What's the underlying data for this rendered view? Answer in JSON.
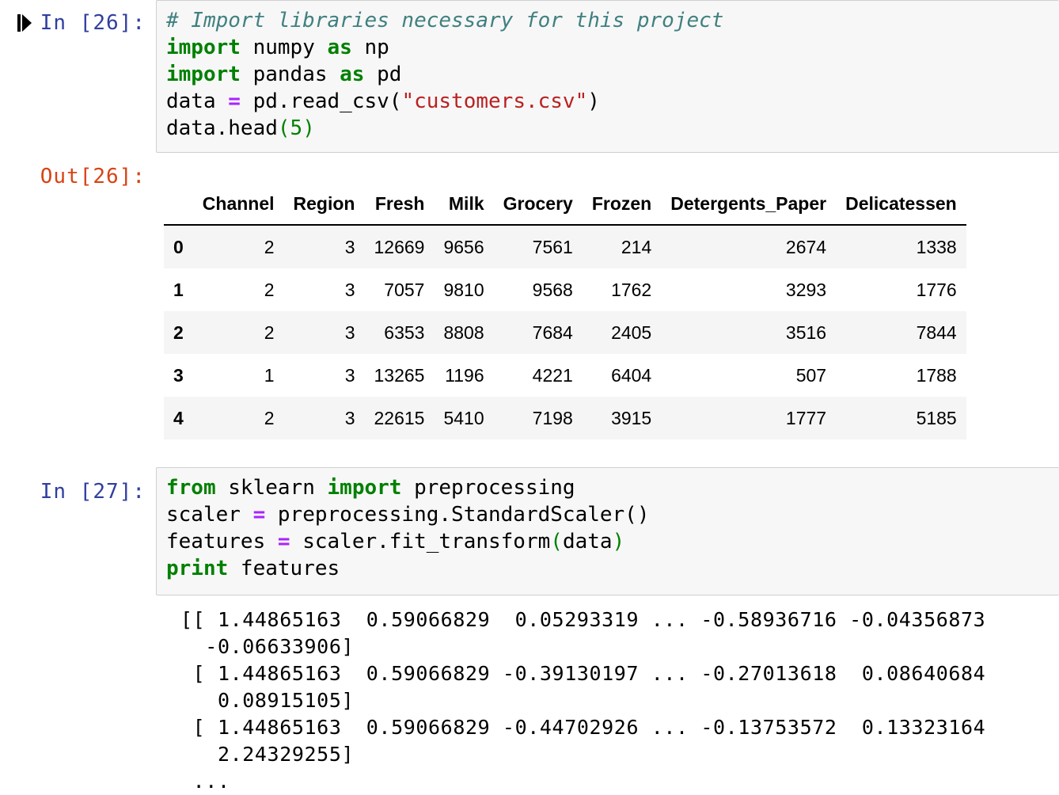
{
  "cells": [
    {
      "prompt": "In [26]:",
      "code_lines": [
        [
          {
            "t": "# Import libraries necessary for this project",
            "c": "cm"
          }
        ],
        [
          {
            "t": "import",
            "c": "kw"
          },
          {
            "t": " numpy ",
            "c": "pn"
          },
          {
            "t": "as",
            "c": "kw"
          },
          {
            "t": " np",
            "c": "pn"
          }
        ],
        [
          {
            "t": "import",
            "c": "kw"
          },
          {
            "t": " pandas ",
            "c": "pn"
          },
          {
            "t": "as",
            "c": "kw"
          },
          {
            "t": " pd",
            "c": "pn"
          }
        ],
        [
          {
            "t": "data ",
            "c": "pn"
          },
          {
            "t": "=",
            "c": "op"
          },
          {
            "t": " pd.read_csv(",
            "c": "pn"
          },
          {
            "t": "\"customers.csv\"",
            "c": "st"
          },
          {
            "t": ")",
            "c": "pn"
          }
        ],
        [
          {
            "t": "data.head",
            "c": "pn"
          },
          {
            "t": "(",
            "c": "num"
          },
          {
            "t": "5",
            "c": "num"
          },
          {
            "t": ")",
            "c": "num"
          }
        ]
      ],
      "out_prompt": "Out[26]:",
      "table": {
        "columns": [
          "Channel",
          "Region",
          "Fresh",
          "Milk",
          "Grocery",
          "Frozen",
          "Detergents_Paper",
          "Delicatessen"
        ],
        "index": [
          "0",
          "1",
          "2",
          "3",
          "4"
        ],
        "rows": [
          [
            "2",
            "3",
            "12669",
            "9656",
            "7561",
            "214",
            "2674",
            "1338"
          ],
          [
            "2",
            "3",
            "7057",
            "9810",
            "9568",
            "1762",
            "3293",
            "1776"
          ],
          [
            "2",
            "3",
            "6353",
            "8808",
            "7684",
            "2405",
            "3516",
            "7844"
          ],
          [
            "1",
            "3",
            "13265",
            "1196",
            "4221",
            "6404",
            "507",
            "1788"
          ],
          [
            "2",
            "3",
            "22615",
            "5410",
            "7198",
            "3915",
            "1777",
            "5185"
          ]
        ]
      }
    },
    {
      "prompt": "In [27]:",
      "code_lines": [
        [
          {
            "t": "from",
            "c": "kw"
          },
          {
            "t": " sklearn ",
            "c": "pn"
          },
          {
            "t": "import",
            "c": "kw"
          },
          {
            "t": " preprocessing",
            "c": "pn"
          }
        ],
        [
          {
            "t": "scaler ",
            "c": "pn"
          },
          {
            "t": "=",
            "c": "op"
          },
          {
            "t": " preprocessing.StandardScaler()",
            "c": "pn"
          }
        ],
        [
          {
            "t": "features ",
            "c": "pn"
          },
          {
            "t": "=",
            "c": "op"
          },
          {
            "t": " scaler.fit_transform",
            "c": "pn"
          },
          {
            "t": "(",
            "c": "num"
          },
          {
            "t": "data",
            "c": "pn"
          },
          {
            "t": ")",
            "c": "num"
          }
        ],
        [
          {
            "t": "print",
            "c": "kw"
          },
          {
            "t": " features",
            "c": "pn"
          }
        ]
      ],
      "stream_lines": [
        "[[ 1.44865163  0.59066829  0.05293319 ... -0.58936716 -0.04356873",
        "  -0.06633906]",
        " [ 1.44865163  0.59066829 -0.39130197 ... -0.27013618  0.08640684",
        "   0.08915105]",
        " [ 1.44865163  0.59066829 -0.44702926 ... -0.13753572  0.13323164",
        "   2.24329255]",
        " ..."
      ]
    }
  ],
  "colors": {
    "keyword": "#008000",
    "comment": "#408080",
    "operator": "#aa22ff",
    "string": "#ba2121",
    "in_prompt": "#303f9f",
    "out_prompt": "#d84315",
    "cell_bg": "#f7f7f7"
  },
  "icons": {
    "run_indicator": "step-forward-icon"
  }
}
